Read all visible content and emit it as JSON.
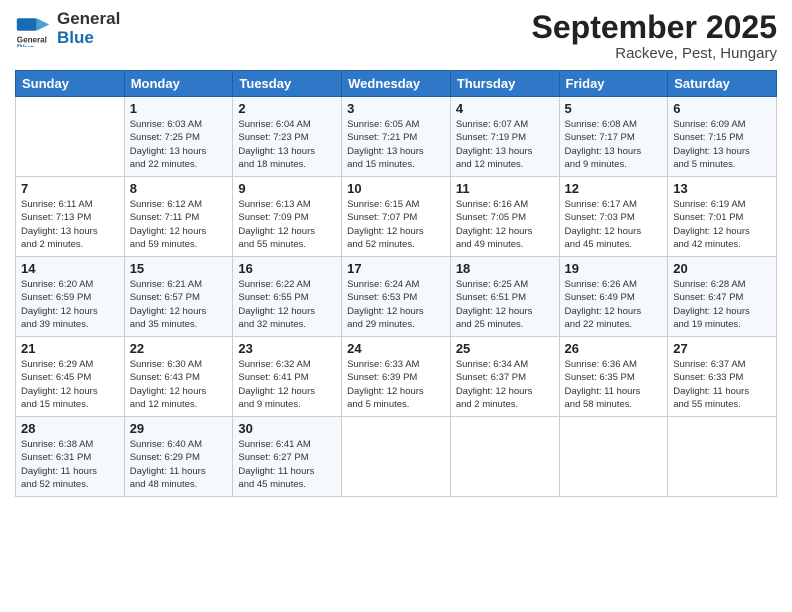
{
  "logo": {
    "line1": "General",
    "line2": "Blue"
  },
  "title": "September 2025",
  "subtitle": "Rackeve, Pest, Hungary",
  "days_of_week": [
    "Sunday",
    "Monday",
    "Tuesday",
    "Wednesday",
    "Thursday",
    "Friday",
    "Saturday"
  ],
  "weeks": [
    [
      {
        "day": "",
        "content": ""
      },
      {
        "day": "1",
        "content": "Sunrise: 6:03 AM\nSunset: 7:25 PM\nDaylight: 13 hours\nand 22 minutes."
      },
      {
        "day": "2",
        "content": "Sunrise: 6:04 AM\nSunset: 7:23 PM\nDaylight: 13 hours\nand 18 minutes."
      },
      {
        "day": "3",
        "content": "Sunrise: 6:05 AM\nSunset: 7:21 PM\nDaylight: 13 hours\nand 15 minutes."
      },
      {
        "day": "4",
        "content": "Sunrise: 6:07 AM\nSunset: 7:19 PM\nDaylight: 13 hours\nand 12 minutes."
      },
      {
        "day": "5",
        "content": "Sunrise: 6:08 AM\nSunset: 7:17 PM\nDaylight: 13 hours\nand 9 minutes."
      },
      {
        "day": "6",
        "content": "Sunrise: 6:09 AM\nSunset: 7:15 PM\nDaylight: 13 hours\nand 5 minutes."
      }
    ],
    [
      {
        "day": "7",
        "content": "Sunrise: 6:11 AM\nSunset: 7:13 PM\nDaylight: 13 hours\nand 2 minutes."
      },
      {
        "day": "8",
        "content": "Sunrise: 6:12 AM\nSunset: 7:11 PM\nDaylight: 12 hours\nand 59 minutes."
      },
      {
        "day": "9",
        "content": "Sunrise: 6:13 AM\nSunset: 7:09 PM\nDaylight: 12 hours\nand 55 minutes."
      },
      {
        "day": "10",
        "content": "Sunrise: 6:15 AM\nSunset: 7:07 PM\nDaylight: 12 hours\nand 52 minutes."
      },
      {
        "day": "11",
        "content": "Sunrise: 6:16 AM\nSunset: 7:05 PM\nDaylight: 12 hours\nand 49 minutes."
      },
      {
        "day": "12",
        "content": "Sunrise: 6:17 AM\nSunset: 7:03 PM\nDaylight: 12 hours\nand 45 minutes."
      },
      {
        "day": "13",
        "content": "Sunrise: 6:19 AM\nSunset: 7:01 PM\nDaylight: 12 hours\nand 42 minutes."
      }
    ],
    [
      {
        "day": "14",
        "content": "Sunrise: 6:20 AM\nSunset: 6:59 PM\nDaylight: 12 hours\nand 39 minutes."
      },
      {
        "day": "15",
        "content": "Sunrise: 6:21 AM\nSunset: 6:57 PM\nDaylight: 12 hours\nand 35 minutes."
      },
      {
        "day": "16",
        "content": "Sunrise: 6:22 AM\nSunset: 6:55 PM\nDaylight: 12 hours\nand 32 minutes."
      },
      {
        "day": "17",
        "content": "Sunrise: 6:24 AM\nSunset: 6:53 PM\nDaylight: 12 hours\nand 29 minutes."
      },
      {
        "day": "18",
        "content": "Sunrise: 6:25 AM\nSunset: 6:51 PM\nDaylight: 12 hours\nand 25 minutes."
      },
      {
        "day": "19",
        "content": "Sunrise: 6:26 AM\nSunset: 6:49 PM\nDaylight: 12 hours\nand 22 minutes."
      },
      {
        "day": "20",
        "content": "Sunrise: 6:28 AM\nSunset: 6:47 PM\nDaylight: 12 hours\nand 19 minutes."
      }
    ],
    [
      {
        "day": "21",
        "content": "Sunrise: 6:29 AM\nSunset: 6:45 PM\nDaylight: 12 hours\nand 15 minutes."
      },
      {
        "day": "22",
        "content": "Sunrise: 6:30 AM\nSunset: 6:43 PM\nDaylight: 12 hours\nand 12 minutes."
      },
      {
        "day": "23",
        "content": "Sunrise: 6:32 AM\nSunset: 6:41 PM\nDaylight: 12 hours\nand 9 minutes."
      },
      {
        "day": "24",
        "content": "Sunrise: 6:33 AM\nSunset: 6:39 PM\nDaylight: 12 hours\nand 5 minutes."
      },
      {
        "day": "25",
        "content": "Sunrise: 6:34 AM\nSunset: 6:37 PM\nDaylight: 12 hours\nand 2 minutes."
      },
      {
        "day": "26",
        "content": "Sunrise: 6:36 AM\nSunset: 6:35 PM\nDaylight: 11 hours\nand 58 minutes."
      },
      {
        "day": "27",
        "content": "Sunrise: 6:37 AM\nSunset: 6:33 PM\nDaylight: 11 hours\nand 55 minutes."
      }
    ],
    [
      {
        "day": "28",
        "content": "Sunrise: 6:38 AM\nSunset: 6:31 PM\nDaylight: 11 hours\nand 52 minutes."
      },
      {
        "day": "29",
        "content": "Sunrise: 6:40 AM\nSunset: 6:29 PM\nDaylight: 11 hours\nand 48 minutes."
      },
      {
        "day": "30",
        "content": "Sunrise: 6:41 AM\nSunset: 6:27 PM\nDaylight: 11 hours\nand 45 minutes."
      },
      {
        "day": "",
        "content": ""
      },
      {
        "day": "",
        "content": ""
      },
      {
        "day": "",
        "content": ""
      },
      {
        "day": "",
        "content": ""
      }
    ]
  ]
}
